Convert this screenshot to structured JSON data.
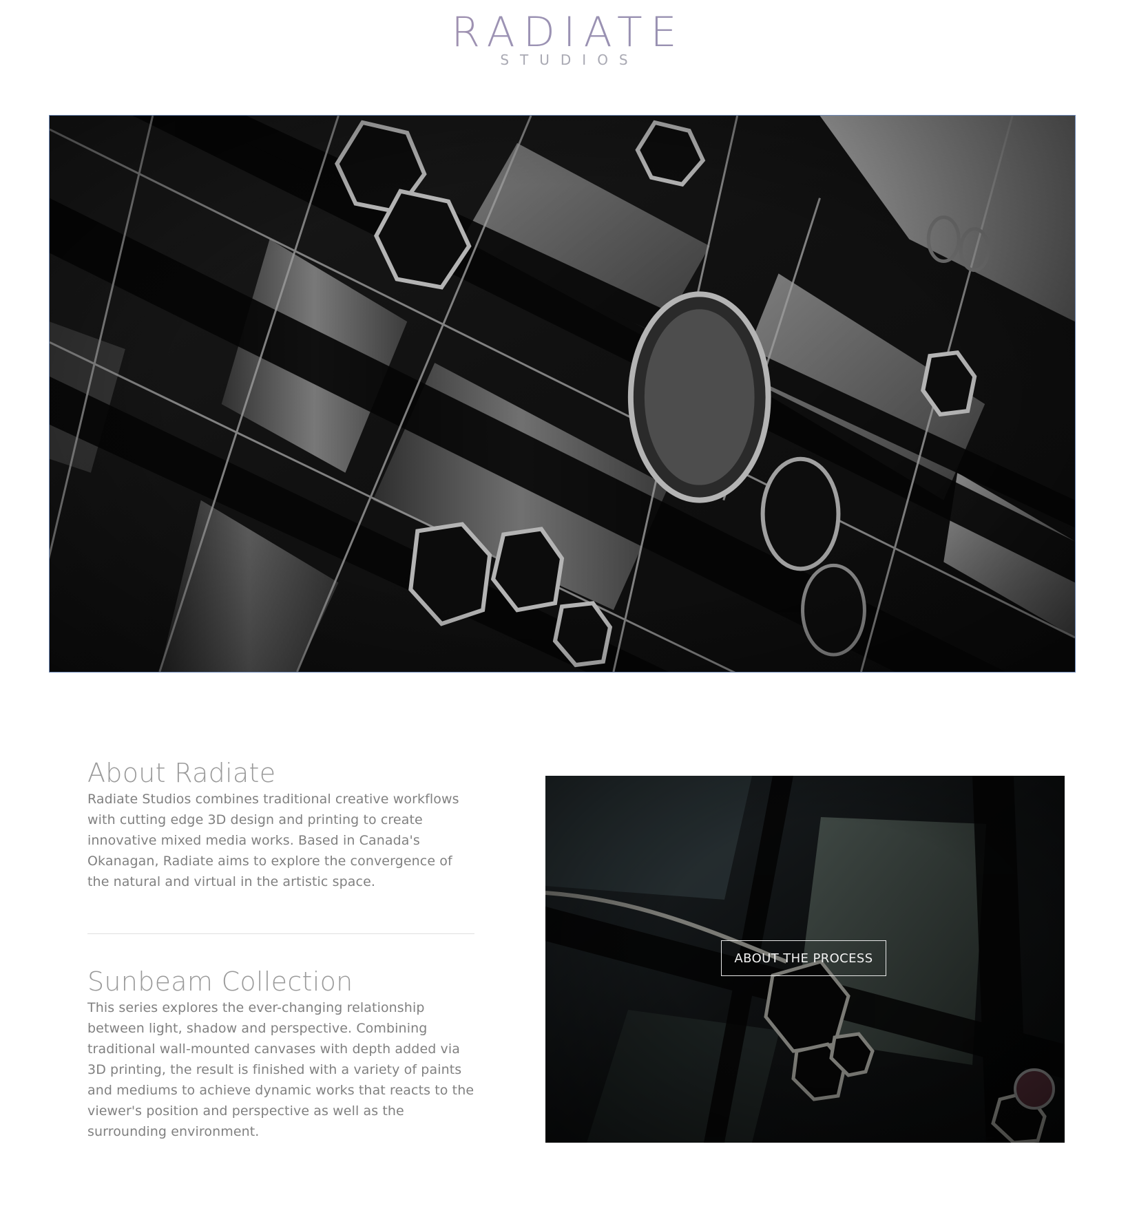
{
  "brand": {
    "name": "RADIATE",
    "sub": "STUDIOS"
  },
  "hero": {
    "image": "3d-printed-hexagon-lattice-artwork"
  },
  "about": {
    "title": "About Radiate",
    "body": "Radiate Studios combines traditional creative workflows with cutting edge 3D design and printing to create innovative mixed media works. Based in Canada's Okanagan, Radiate aims to explore the convergence of the natural and virtual in the artistic space."
  },
  "sunbeam": {
    "title": "Sunbeam Collection",
    "body": "This series explores the ever-changing relationship between light, shadow and perspective. Combining traditional wall-mounted canvases with depth added via 3D printing, the result is finished with a variety of paints and mediums to achieve dynamic works that reacts to the viewer's position and perspective as well as the surrounding environment."
  },
  "process": {
    "button_label": "ABOUT THE PROCESS",
    "image": "dark-hexagon-artwork-detail"
  },
  "colors": {
    "logo_gradient_start": "#b07a8f",
    "logo_gradient_end": "#8b87a7",
    "text": "#808080",
    "hero_border": "#6f8ab8"
  }
}
